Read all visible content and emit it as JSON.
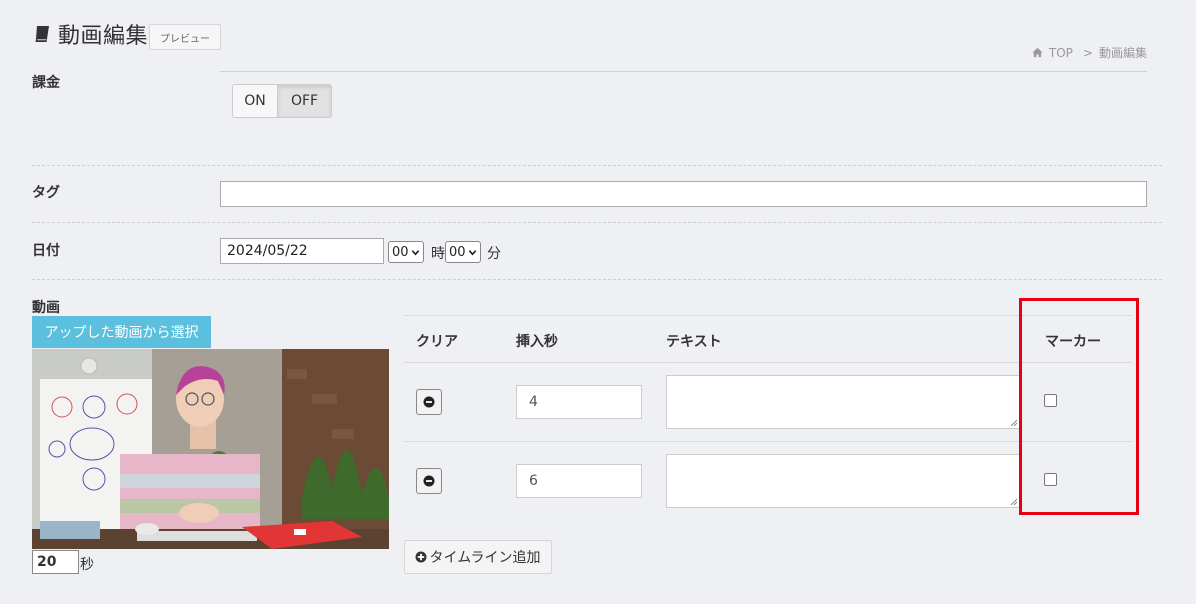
{
  "header": {
    "title": "動画編集",
    "preview_label": "プレビュー",
    "breadcrumb": {
      "home": "TOP",
      "separator": ">",
      "current": "動画編集"
    }
  },
  "billing": {
    "label": "課金",
    "on_label": "ON",
    "off_label": "OFF",
    "selected": "OFF"
  },
  "tag": {
    "label": "タグ",
    "value": ""
  },
  "date": {
    "label": "日付",
    "value": "2024/05/22",
    "hour": "00",
    "hour_unit": "時",
    "minute": "00",
    "minute_unit": "分"
  },
  "video": {
    "label": "動画",
    "select_button": "アップした動画から選択",
    "seconds_value": "20",
    "seconds_unit": "秒"
  },
  "timeline": {
    "columns": [
      "クリア",
      "挿入秒",
      "テキスト",
      "マーカー"
    ],
    "rows": [
      {
        "seconds": "4",
        "text": "",
        "marker": false
      },
      {
        "seconds": "6",
        "text": "",
        "marker": false
      }
    ],
    "add_button": "タイムライン追加"
  },
  "colors": {
    "background": "#eff0f4",
    "info_button": "#5bc0de",
    "highlight": "#e60012"
  }
}
